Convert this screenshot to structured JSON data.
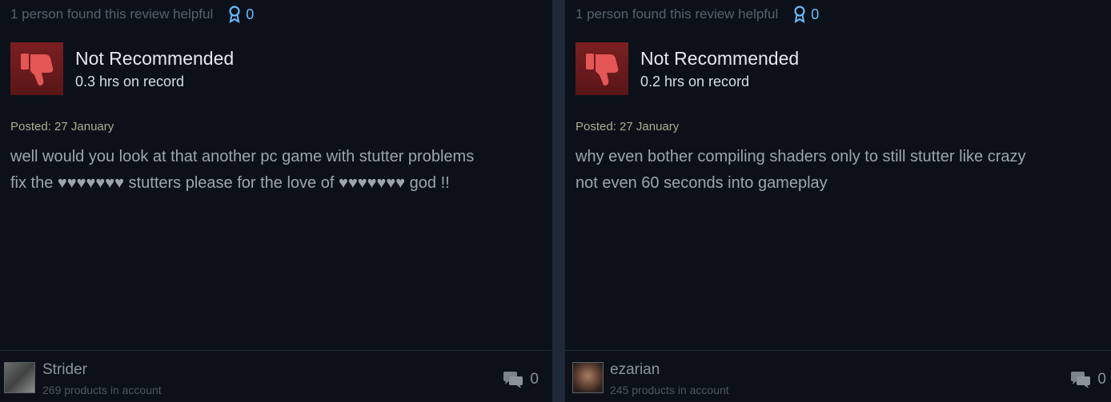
{
  "reviews": [
    {
      "helpful_text": "1 person found this review helpful",
      "award_count": "0",
      "verdict": "Not Recommended",
      "hours": "0.3 hrs on record",
      "posted": "Posted: 27 January",
      "body_line1": "well would you look at that another pc game with stutter problems",
      "body_line2": "fix the ♥♥♥♥♥♥♥ stutters please for the love of ♥♥♥♥♥♥♥ god !!",
      "user_name": "Strider",
      "products": "269 products in account",
      "comment_count": "0"
    },
    {
      "helpful_text": "1 person found this review helpful",
      "award_count": "0",
      "verdict": "Not Recommended",
      "hours": "0.2 hrs on record",
      "posted": "Posted: 27 January",
      "body_line1": "why even bother compiling shaders only to still stutter like crazy",
      "body_line2": "not even 60 seconds into gameplay",
      "user_name": "ezarian",
      "products": "245 products in account",
      "comment_count": "0"
    }
  ],
  "colors": {
    "background": "#0c1119",
    "thumb_bg": "#7a1f21",
    "thumb_icon": "#e55656",
    "award": "#67bcff",
    "posted": "#a6b08e"
  },
  "icons": {
    "award": "award-ribbon-icon",
    "thumb": "thumbs-down-icon",
    "comment": "comment-bubbles-icon"
  }
}
